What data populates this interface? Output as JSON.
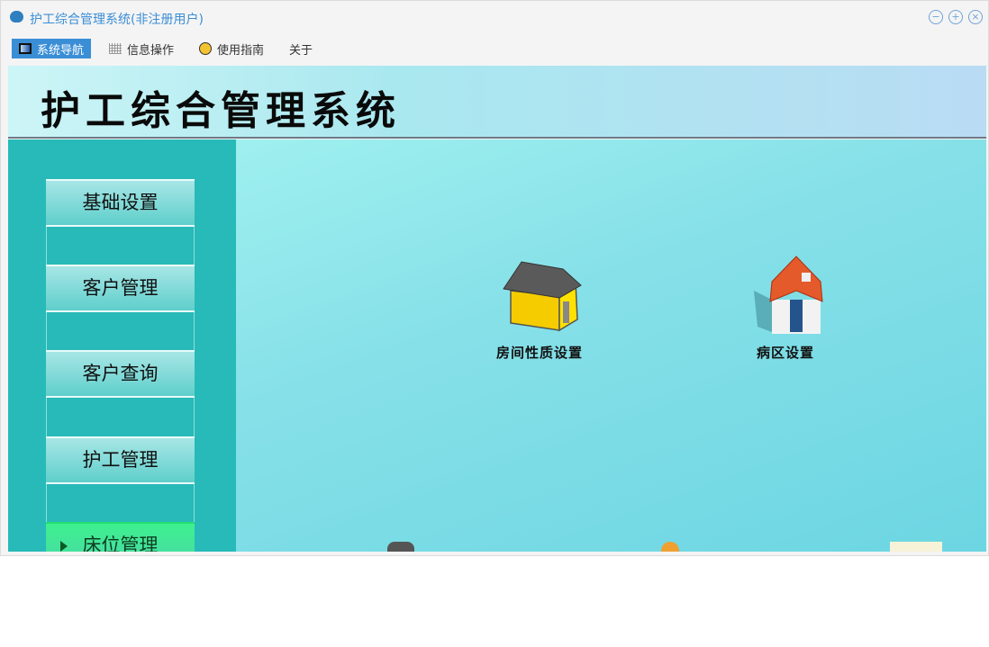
{
  "window": {
    "title": "护工综合管理系统(非注册用户)"
  },
  "menubar": [
    {
      "label": "系统导航",
      "icon": "monitor-icon",
      "active": true
    },
    {
      "label": "信息操作",
      "icon": "grid-icon"
    },
    {
      "label": "使用指南",
      "icon": "help-icon"
    },
    {
      "label": "关于"
    }
  ],
  "header": {
    "title": "护工综合管理系统"
  },
  "sidebar": {
    "items": [
      {
        "label": "基础设置"
      },
      {
        "label": "客户管理"
      },
      {
        "label": "客户查询"
      },
      {
        "label": "护工管理"
      },
      {
        "label": "床位管理",
        "active": true
      }
    ]
  },
  "main": {
    "tiles": [
      {
        "label": "房间性质设置",
        "icon": "yellow-house-icon"
      },
      {
        "label": "病区设置",
        "icon": "red-house-icon"
      }
    ]
  },
  "colors": {
    "accent": "#3a8ed6",
    "sidebar": "#27bab8",
    "active_nav": "#3ef08e"
  }
}
